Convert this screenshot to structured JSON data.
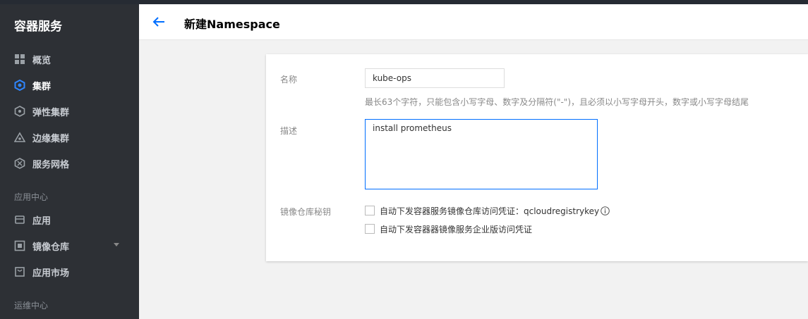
{
  "sidebar": {
    "brand": "容器服务",
    "items": [
      {
        "label": "概览",
        "icon": "grid-icon"
      },
      {
        "label": "集群",
        "icon": "cluster-icon",
        "active": true
      },
      {
        "label": "弹性集群",
        "icon": "elastic-icon"
      },
      {
        "label": "边缘集群",
        "icon": "edge-icon"
      },
      {
        "label": "服务网格",
        "icon": "mesh-icon"
      }
    ],
    "section_app": "应用中心",
    "app_items": [
      {
        "label": "应用",
        "icon": "app-icon"
      },
      {
        "label": "镜像仓库",
        "icon": "image-repo-icon",
        "expandable": true
      },
      {
        "label": "应用市场",
        "icon": "market-icon"
      }
    ],
    "section_ops": "运维中心"
  },
  "header": {
    "title": "新建Namespace"
  },
  "form": {
    "name_label": "名称",
    "name_value": "kube-ops",
    "name_hint": "最长63个字符，只能包含小写字母、数字及分隔符(\"-\")，且必须以小写字母开头，数字或小写字母结尾",
    "desc_label": "描述",
    "desc_value": "install prometheus",
    "secret_label": "镜像仓库秘钥",
    "checkbox1": "自动下发容器服务镜像仓库访问凭证：qcloudregistrykey",
    "checkbox2": "自动下发容器器镜像服务企业版访问凭证"
  },
  "colors": {
    "accent": "#006eff",
    "sidebar_bg": "#2d3035"
  }
}
